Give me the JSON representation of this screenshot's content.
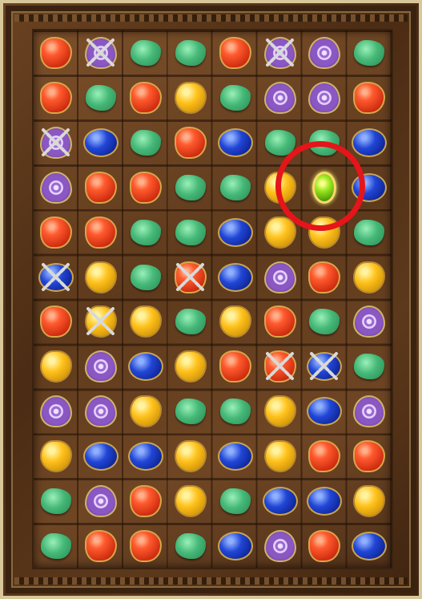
{
  "board": {
    "rows": 12,
    "cols": 8,
    "grid": [
      [
        "red",
        "purple-chained",
        "green",
        "green",
        "red",
        "purple-chained",
        "purple",
        "green"
      ],
      [
        "red",
        "green",
        "red",
        "yellow",
        "green",
        "purple",
        "purple",
        "red"
      ],
      [
        "purple-chained",
        "blue",
        "green",
        "red",
        "blue",
        "green",
        "green",
        "blue"
      ],
      [
        "purple",
        "red",
        "red",
        "green",
        "green",
        "yellow",
        "bonus",
        "blue"
      ],
      [
        "red",
        "red",
        "green",
        "green",
        "blue",
        "yellow",
        "yellow",
        "green"
      ],
      [
        "blue-chained",
        "yellow",
        "green",
        "red-chained",
        "blue",
        "purple",
        "red",
        "yellow"
      ],
      [
        "red",
        "yellow-chained",
        "yellow",
        "green",
        "yellow",
        "red",
        "green",
        "purple"
      ],
      [
        "yellow",
        "purple",
        "blue",
        "yellow",
        "red",
        "red-chained",
        "blue-chained",
        "green"
      ],
      [
        "purple",
        "purple",
        "yellow",
        "green",
        "green",
        "yellow",
        "blue",
        "purple"
      ],
      [
        "yellow",
        "blue",
        "blue",
        "yellow",
        "blue",
        "yellow",
        "red",
        "red"
      ],
      [
        "green",
        "purple",
        "red",
        "yellow",
        "green",
        "blue",
        "blue",
        "yellow"
      ],
      [
        "green",
        "red",
        "red",
        "green",
        "blue",
        "purple",
        "red",
        "blue"
      ]
    ],
    "highlight": {
      "row": 3,
      "col": 6,
      "color": "#e5151a"
    }
  },
  "colors": {
    "frame_border": "#d8c79a",
    "board_wood": "#6a4221"
  }
}
